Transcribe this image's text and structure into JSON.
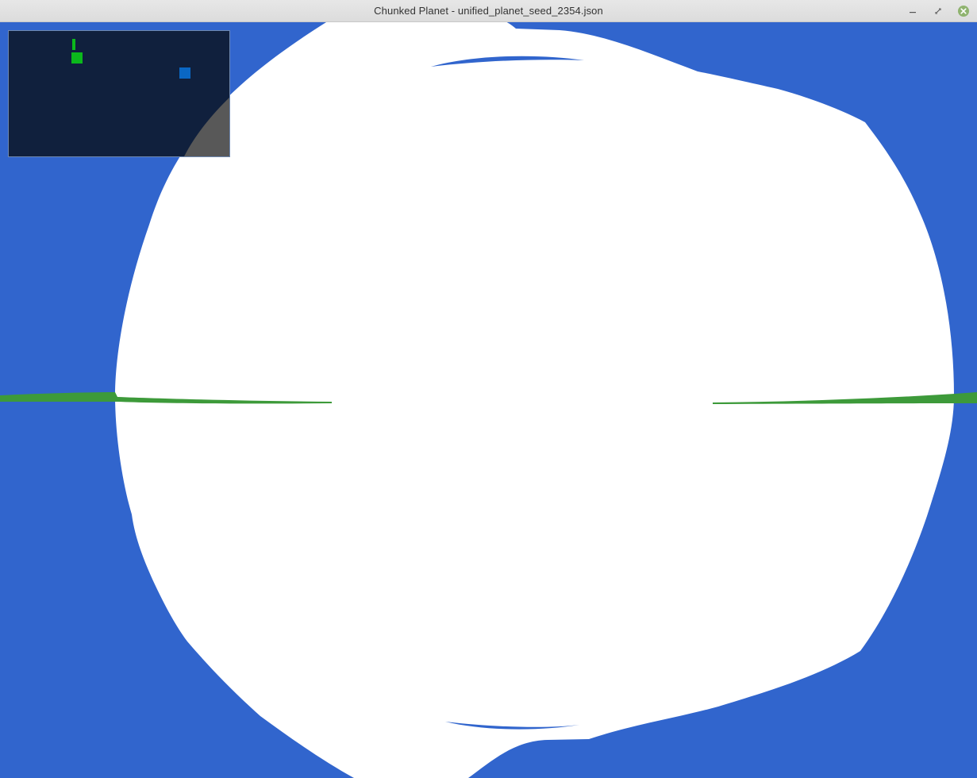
{
  "window": {
    "title": "Chunked Planet - unified_planet_seed_2354.json"
  },
  "controls": {
    "minimize_icon": "minimize-icon",
    "restore_icon": "restore-icon",
    "close_icon": "close-icon"
  },
  "colors": {
    "sky": "#3165cd",
    "planet": "#ffffff",
    "horizon_band": "#3d9a3a",
    "minimap_bg": "#10203d",
    "minimap_player": "#0bb81c",
    "minimap_target": "#0a67c4",
    "minimap_shadow": "#585858"
  }
}
